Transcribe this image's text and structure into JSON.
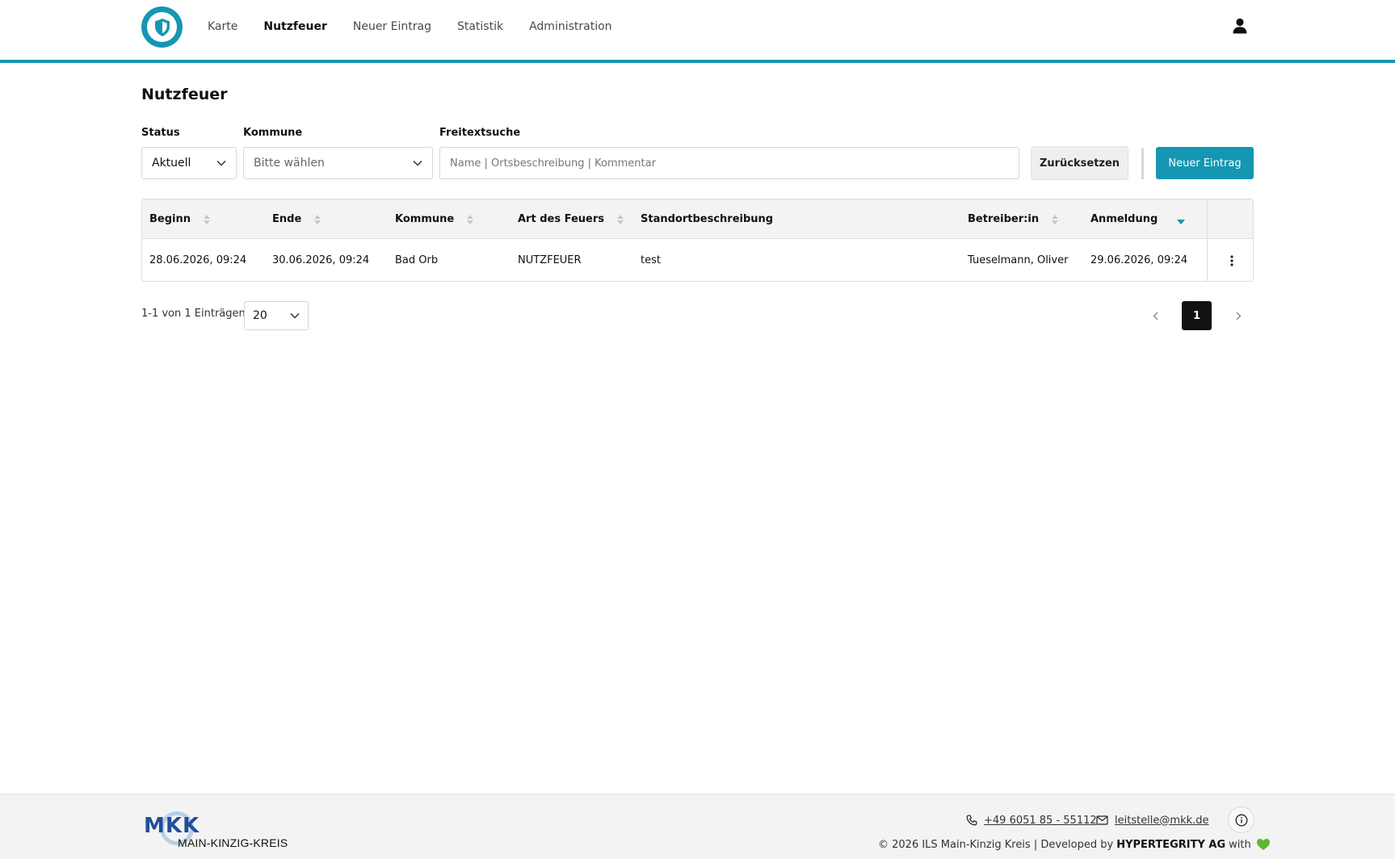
{
  "nav": {
    "items": [
      {
        "label": "Karte",
        "active": false
      },
      {
        "label": "Nutzfeuer",
        "active": true
      },
      {
        "label": "Neuer Eintrag",
        "active": false
      },
      {
        "label": "Statistik",
        "active": false
      },
      {
        "label": "Administration",
        "active": false
      }
    ]
  },
  "page": {
    "title": "Nutzfeuer"
  },
  "filters": {
    "status": {
      "label": "Status",
      "value": "Aktuell"
    },
    "kommune": {
      "label": "Kommune",
      "placeholder": "Bitte wählen"
    },
    "freitext": {
      "label": "Freitextsuche",
      "placeholder": "Name | Ortsbeschreibung | Kommentar"
    },
    "reset_label": "Zurücksetzen",
    "new_label": "Neuer Eintrag"
  },
  "table": {
    "columns": [
      "Beginn",
      "Ende",
      "Kommune",
      "Art des Feuers",
      "Standortbeschreibung",
      "Betreiber:in",
      "Anmeldung"
    ],
    "rows": [
      [
        "28.06.2026, 09:24",
        "30.06.2026, 09:24",
        "Bad Orb",
        "NUTZFEUER",
        "test",
        "Tueselmann, Oliver",
        "29.06.2026, 09:24"
      ]
    ]
  },
  "pagination": {
    "count_text": "1-1 von 1 Einträgen",
    "page_size": "20",
    "current_page": "1"
  },
  "footer": {
    "logo_letters": "MKK",
    "logo_sub": "MAIN-KINZIG-KREIS",
    "phone": "+49 6051 85 - 55112",
    "email": "leitstelle@mkk.de",
    "copyright": "© 2026 ILS Main-Kinzig Kreis | Developed by",
    "company": "HYPERTEGRITY AG",
    "with": "with"
  },
  "colors": {
    "accent": "#1596b3",
    "heart": "#5cb82e"
  }
}
